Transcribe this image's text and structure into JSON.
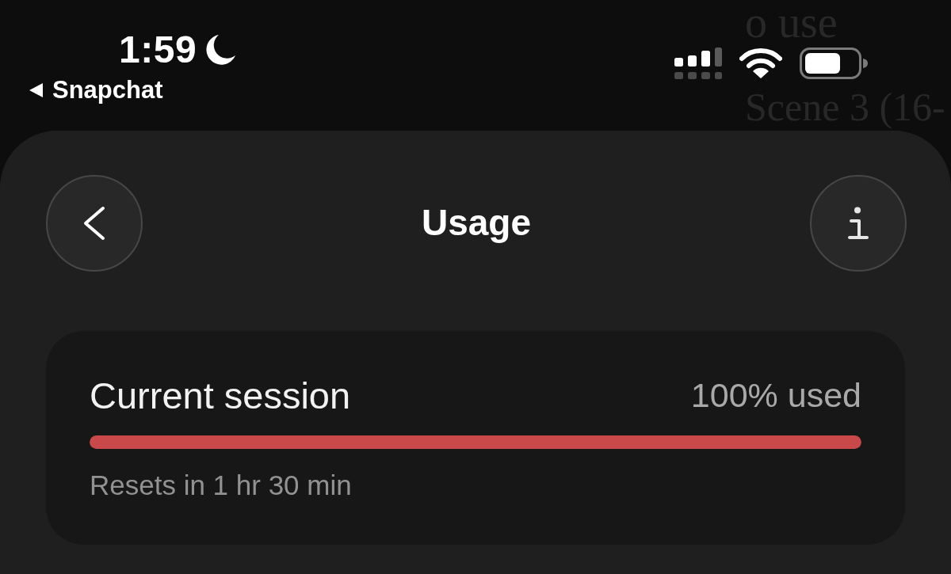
{
  "background_text": [
    "o use",
    "Scene 3 (16-"
  ],
  "status_bar": {
    "time": "1:59",
    "back_app": "Snapchat"
  },
  "header": {
    "title": "Usage"
  },
  "usage": [
    {
      "label": "Current session",
      "reading": "100% used",
      "level": 1,
      "note": "Resets in 1 hr 30 min"
    }
  ]
}
